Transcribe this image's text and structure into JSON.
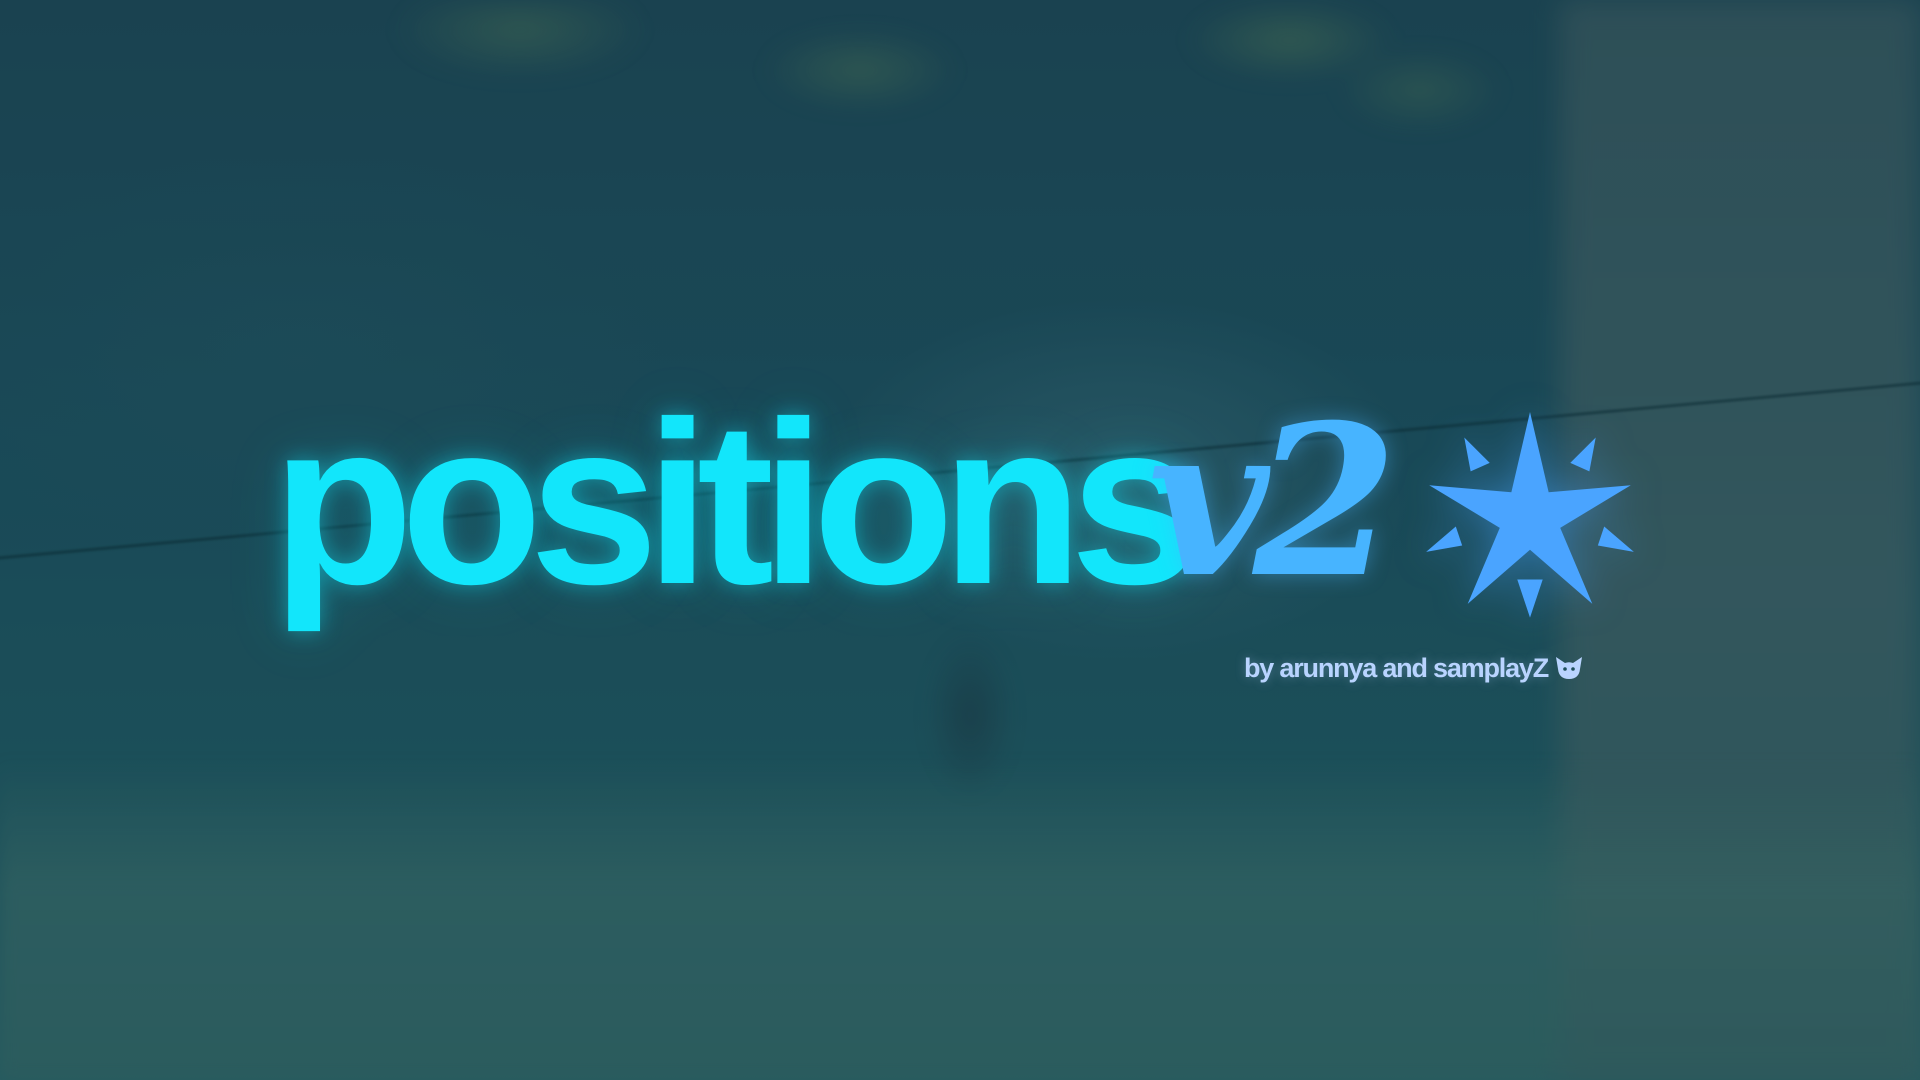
{
  "title": {
    "word": "positions",
    "version": "v2"
  },
  "credit": {
    "text": "by arunnya and samplayZ",
    "icon": "cat-face-icon"
  },
  "decoration": {
    "icon": "sparkle-star-icon"
  },
  "colors": {
    "title": "#12e6fb",
    "version": "#47b4ff",
    "star": "#4aa4ff",
    "credit": "#b9d4ff"
  }
}
